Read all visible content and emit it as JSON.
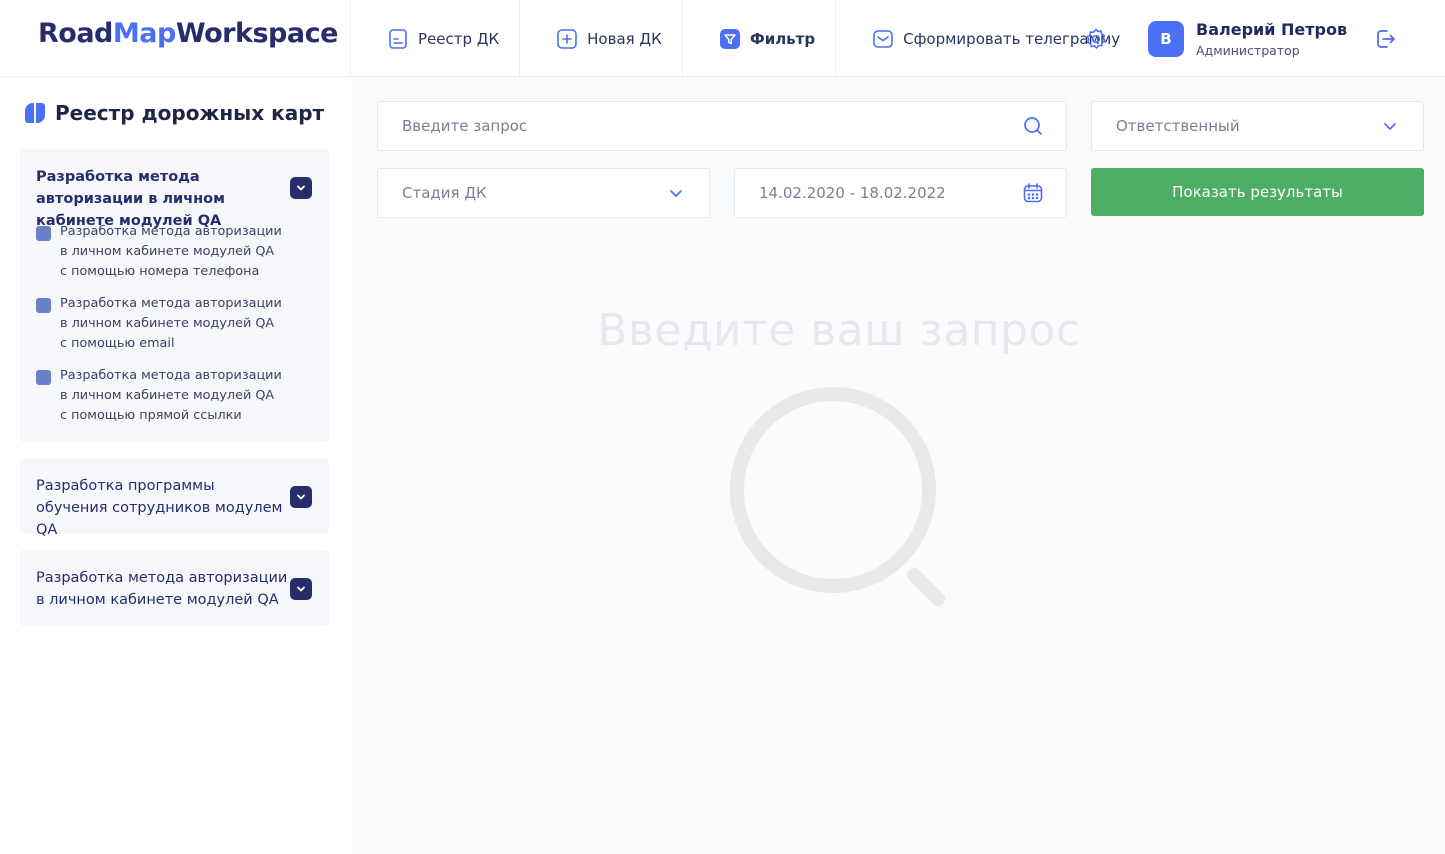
{
  "app": {
    "logo_part1": "Road",
    "logo_part2": "Map",
    "logo_part3": "Workspace"
  },
  "nav": {
    "items": [
      {
        "label": "Реестр ДК",
        "icon": "document-icon"
      },
      {
        "label": "Новая ДК",
        "icon": "plus-square-icon"
      },
      {
        "label": "Фильтр",
        "icon": "filter-icon",
        "active": true
      },
      {
        "label": "Сформировать телеграмму",
        "icon": "mail-icon"
      }
    ]
  },
  "user": {
    "initial": "В",
    "name": "Валерий Петров",
    "role": "Администратор"
  },
  "sidebar": {
    "title": "Реестр дорожных карт",
    "cards": [
      {
        "title": "Разработка метода авторизации в личном кабинете модулей QA",
        "expanded": true,
        "items": [
          "Разработка метода авторизации\nв личном кабинете модулей QA\nс помощью номера телефона",
          "Разработка метода авторизации\nв личном кабинете модулей QA\nс помощью email",
          "Разработка метода авторизации\nв личном кабинете модулей QA\nс помощью прямой ссылки"
        ]
      },
      {
        "title": "Разработка программы обучения сотрудников модулем QA",
        "expanded": false
      },
      {
        "title": "Разработка метода авторизации в личном кабинете модулей QA",
        "expanded": false
      }
    ]
  },
  "filters": {
    "search_placeholder": "Введите запрос",
    "responsible": "Ответственный",
    "stage": "Стадия ДК",
    "date_range": "14.02.2020 - 18.02.2022",
    "show_button": "Показать результаты"
  },
  "empty_state": {
    "title": "Введите ваш запрос"
  },
  "colors": {
    "brand_dark": "#262d6b",
    "brand_blue": "#4b6ff5",
    "accent_green": "#4cae62"
  }
}
